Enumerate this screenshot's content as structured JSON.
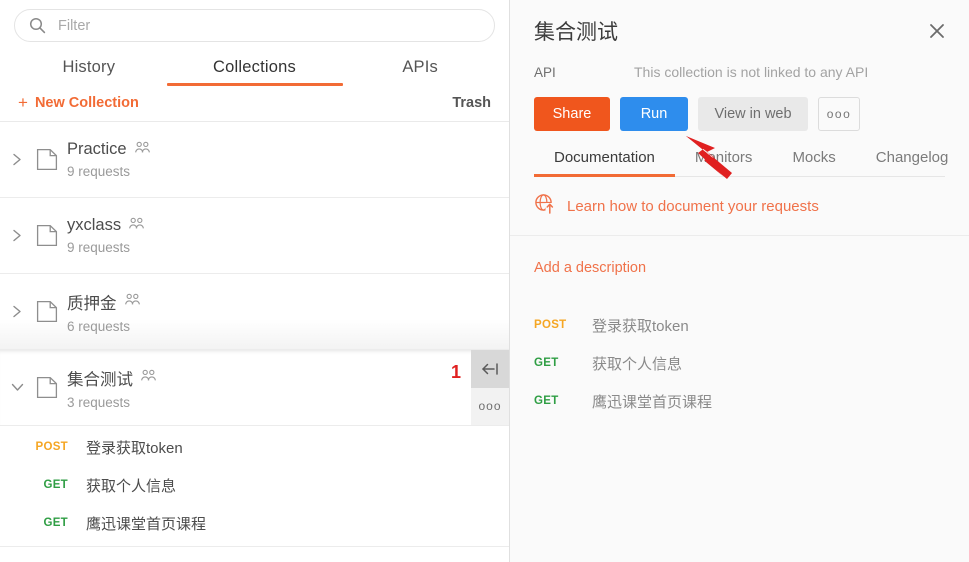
{
  "sidebar": {
    "search": {
      "placeholder": "Filter",
      "value": "",
      "icon": "search-icon"
    },
    "tabs": [
      {
        "label": "History",
        "active": false
      },
      {
        "label": "Collections",
        "active": true
      },
      {
        "label": "APIs",
        "active": false
      }
    ],
    "new_collection_label": "New Collection",
    "new_collection_plus": "+",
    "trash_label": "Trash",
    "collections": [
      {
        "name": "Practice",
        "count": "9 requests",
        "expanded": false,
        "shared": true
      },
      {
        "name": "yxclass",
        "count": "9 requests",
        "expanded": false,
        "shared": true
      },
      {
        "name": "质押金",
        "count": "6 requests",
        "expanded": false,
        "shared": true
      },
      {
        "name": "集合测试",
        "count": "3 requests",
        "expanded": true,
        "shared": true,
        "selected": true
      }
    ],
    "row_actions": {
      "collapse_icon": "collapse-left-icon",
      "more_label": "ooo",
      "annotation_badge": "1"
    },
    "requests": [
      {
        "method": "POST",
        "name": "登录获取token"
      },
      {
        "method": "GET",
        "name": "获取个人信息"
      },
      {
        "method": "GET",
        "name": "鹰迅课堂首页课程"
      }
    ]
  },
  "detail": {
    "title": "集合测试",
    "close_icon": "close-icon",
    "api_label": "API",
    "api_value": "This collection is not linked to any API",
    "buttons": [
      {
        "label": "Share",
        "name": "share-button",
        "color": "#f0561d"
      },
      {
        "label": "Run",
        "name": "run-button",
        "color": "#2e8ded"
      },
      {
        "label": "View in web",
        "name": "view-in-web-button",
        "color": "#e9e9e9"
      },
      {
        "label": "ooo",
        "name": "more-options-button",
        "color": "#fafafa"
      }
    ],
    "tabs": [
      {
        "label": "Documentation",
        "active": true
      },
      {
        "label": "Monitors",
        "active": false
      },
      {
        "label": "Mocks",
        "active": false
      },
      {
        "label": "Changelog",
        "active": false
      }
    ],
    "doc_link": {
      "icon": "globe-upload-icon",
      "label": "Learn how to document your requests"
    },
    "add_description": "Add a description",
    "requests": [
      {
        "method": "POST",
        "name": "登录获取token"
      },
      {
        "method": "GET",
        "name": "获取个人信息"
      },
      {
        "method": "GET",
        "name": "鹰迅课堂首页课程"
      }
    ]
  },
  "annotation": {
    "arrow_color": "#e02020",
    "badge_color": "#e02020"
  }
}
